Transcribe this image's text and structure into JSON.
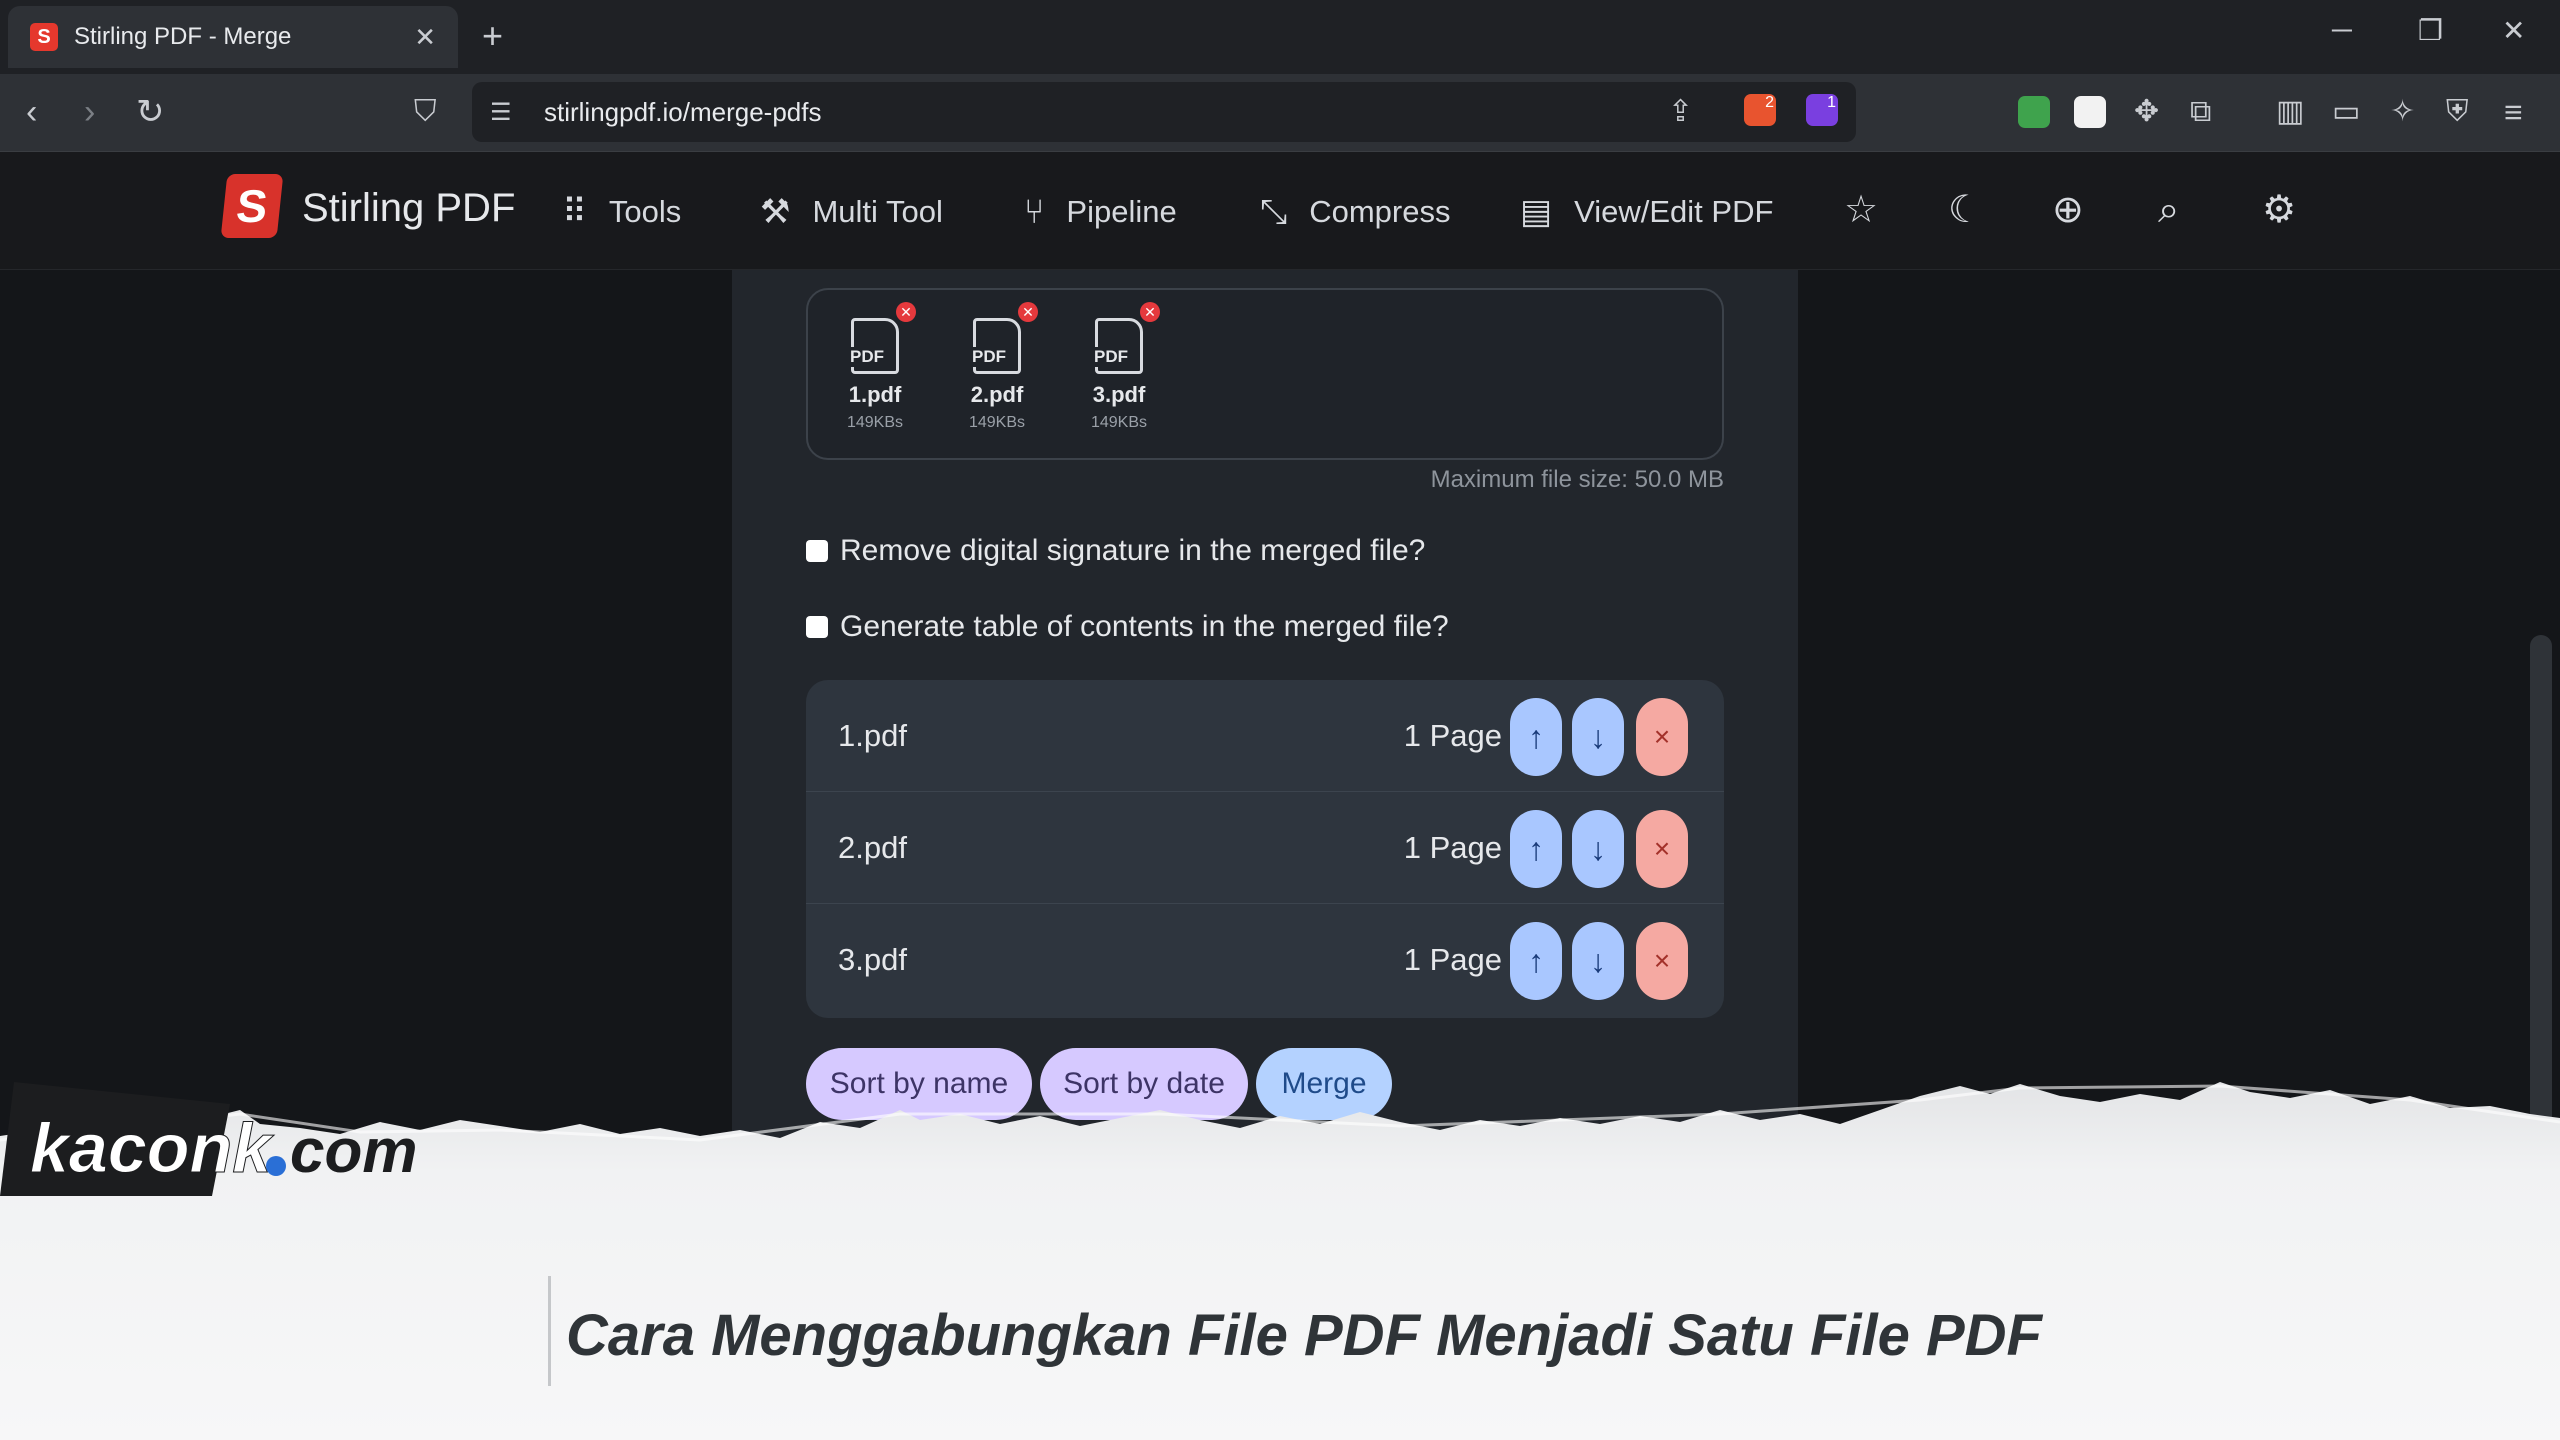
{
  "browser": {
    "tab_title": "Stirling PDF - Merge",
    "tab_close": "✕",
    "new_tab": "+",
    "url": "stirlingpdf.io/merge-pdfs",
    "badge_brave": "2",
    "badge_alert": "1"
  },
  "app": {
    "brand": "Stirling PDF",
    "nav": [
      {
        "label": "Tools",
        "icon": "grid-icon"
      },
      {
        "label": "Multi Tool",
        "icon": "tools-icon"
      },
      {
        "label": "Pipeline",
        "icon": "pipeline-icon"
      },
      {
        "label": "Compress",
        "icon": "compress-icon"
      },
      {
        "label": "View/Edit PDF",
        "icon": "book-icon"
      }
    ]
  },
  "upload": {
    "files": [
      {
        "name": "1.pdf",
        "size": "149KBs",
        "badge": "PDF"
      },
      {
        "name": "2.pdf",
        "size": "149KBs",
        "badge": "PDF"
      },
      {
        "name": "3.pdf",
        "size": "149KBs",
        "badge": "PDF"
      }
    ],
    "max_size": "Maximum file size: 50.0 MB"
  },
  "options": {
    "remove_signature": "Remove digital signature in the merged file?",
    "generate_toc": "Generate table of contents in the merged file?"
  },
  "file_list": [
    {
      "name": "1.pdf",
      "pages": "1 Page"
    },
    {
      "name": "2.pdf",
      "pages": "1 Page"
    },
    {
      "name": "3.pdf",
      "pages": "1 Page"
    }
  ],
  "actions": {
    "sort_by_name": "Sort by name",
    "sort_by_date": "Sort by date",
    "merge": "Merge"
  },
  "watermark": {
    "site": "kaconk.com",
    "title": "Cara Menggabungkan File PDF Menjadi Satu File PDF"
  },
  "colors": {
    "accent_blue": "#a9c7ff",
    "accent_purple": "#d6c9ff",
    "danger": "#f5a9a2",
    "brand_red": "#d8322b"
  }
}
